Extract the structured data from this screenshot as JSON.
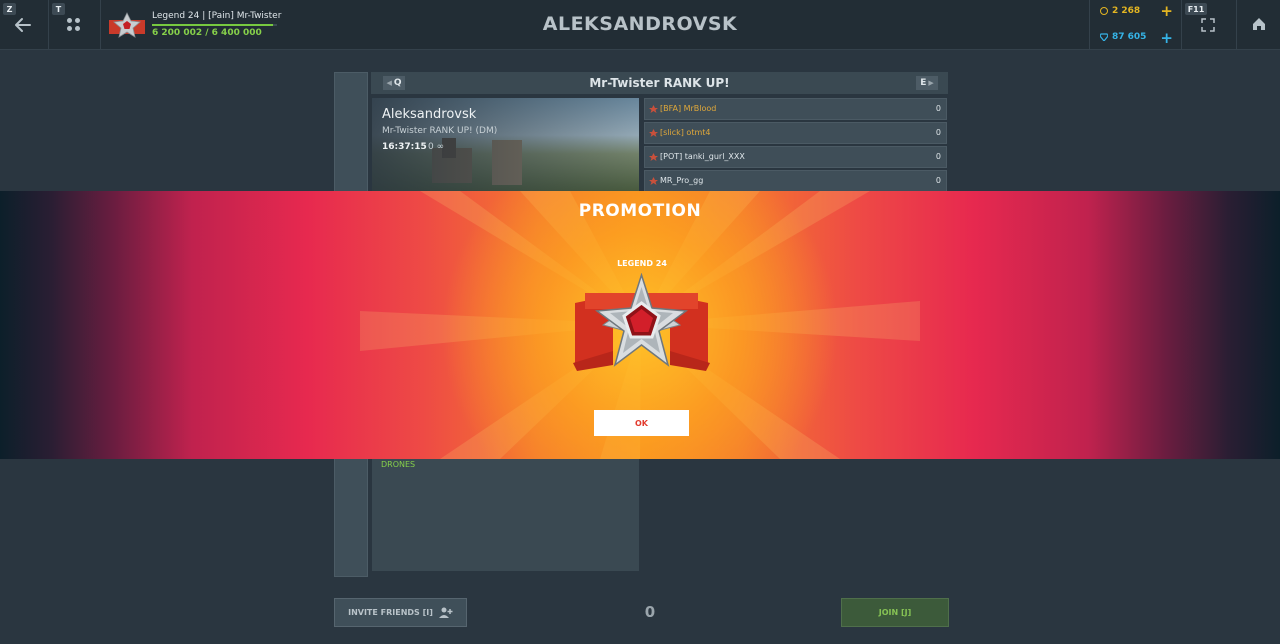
{
  "topbar": {
    "back_key": "Z",
    "squad_key": "T",
    "player_name": "Legend 24 | [Pain] Mr-Twister",
    "experience": "6 200 002 / 6 400 000",
    "experience_progress": 0.969,
    "crystals": "2 268",
    "rubies": "87 605",
    "fullscreen_key": "F11"
  },
  "map_title": "ALEKSANDROVSK",
  "battle": {
    "title": "Mr-Twister RANK UP!",
    "prev_key": "Q",
    "next_key": "E",
    "map_name": "Aleksandrovsk",
    "battle_name": "Mr-Twister RANK UP! (DM)",
    "time": "16:37:15",
    "limit": "0",
    "limit_symbol": "∞",
    "players": [
      {
        "name": "[BFA] MrBlood",
        "score": "0",
        "color": "#e0a83a"
      },
      {
        "name": "[slick] otmt4",
        "score": "0",
        "color": "#e0a83a"
      },
      {
        "name": "[POT] tanki_gurl_XXX",
        "score": "0",
        "color": "#dfe6ea"
      },
      {
        "name": "MR_Pro_gg",
        "score": "0",
        "color": "#dfe6ea"
      }
    ],
    "drones_label": "DRONES"
  },
  "bottom": {
    "invite_label": "INVITE FRIENDS [I]",
    "player_count": "0",
    "join_label": "JOIN [J]"
  },
  "promotion": {
    "title": "PROMOTION",
    "rank_name": "LEGEND 24",
    "ok_label": "OK"
  },
  "colors": {
    "accent_green": "#86d04a",
    "crystal": "#e3b522",
    "ruby": "#35b3e6",
    "promo_red": "#e7294f",
    "promo_orange": "#f78a22"
  },
  "icons": [
    "arrow-left-icon",
    "squad-icon",
    "rank-icon",
    "coin-icon",
    "gem-icon",
    "plus-icon",
    "fullscreen-icon",
    "home-icon",
    "invite-friends-icon"
  ]
}
